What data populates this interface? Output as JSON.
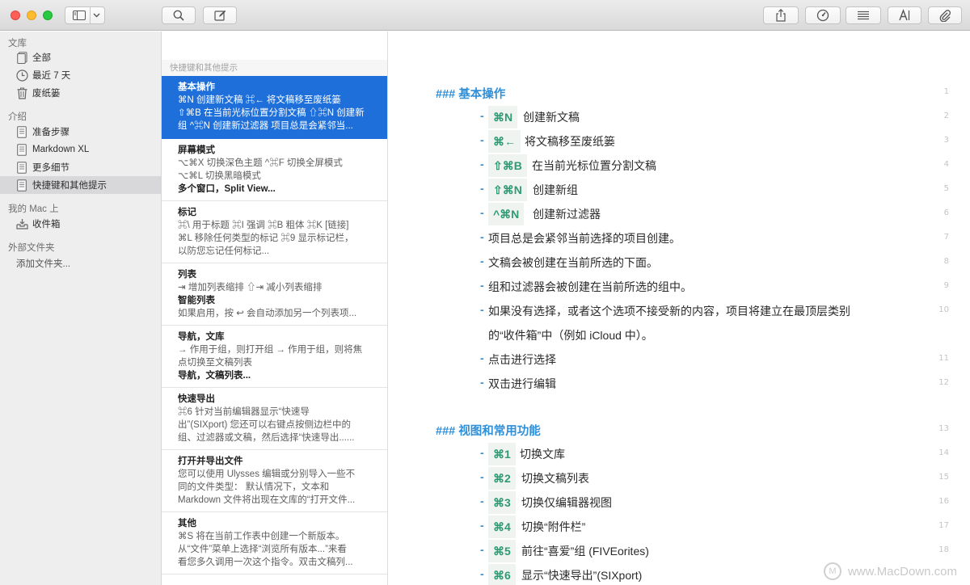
{
  "toolbar": {
    "icons": [
      "sidebar-toggle-icon",
      "chevron-down-icon",
      "search-icon",
      "compose-icon",
      "share-icon",
      "dashboard-icon",
      "list-icon",
      "typography-icon",
      "attachment-icon"
    ]
  },
  "sidebar": {
    "library_header": "文库",
    "library_items": [
      {
        "label": "全部",
        "icon": "sheets-stack-icon"
      },
      {
        "label": "最近 7 天",
        "icon": "clock-icon"
      },
      {
        "label": "废纸篓",
        "icon": "trash-icon"
      }
    ],
    "intro_header": "介绍",
    "intro_items": [
      {
        "label": "准备步骤",
        "icon": "document-icon"
      },
      {
        "label": "Markdown XL",
        "icon": "document-icon"
      },
      {
        "label": "更多细节",
        "icon": "document-icon"
      },
      {
        "label": "快捷键和其他提示",
        "icon": "document-icon"
      }
    ],
    "mac_header": "我的 Mac 上",
    "mac_items": [
      {
        "label": "收件箱",
        "icon": "inbox-icon"
      }
    ],
    "external_header": "外部文件夹",
    "add_folder": "添加文件夹..."
  },
  "list": {
    "header": "快捷键和其他提示",
    "sheets": [
      {
        "title": "基本操作",
        "lines": [
          "⌘N 创建新文稿 ⌘← 将文稿移至废纸篓",
          "⇧⌘B 在当前光标位置分割文稿 ⇧⌘N 创建新",
          "组 ^⌘N 创建新过滤器 项目总是会紧邻当..."
        ]
      },
      {
        "title": "屏幕模式",
        "lines": [
          "⌥⌘X 切换深色主题 ^⌘F 切换全屏模式",
          "⌥⌘L 切换黑暗模式"
        ],
        "bold": "多个窗口，Split View..."
      },
      {
        "title": "标记",
        "lines": [
          "⌘\\ 用于标题 ⌘I 强调 ⌘B 粗体 ⌘K [链接]",
          "⌘L 移除任何类型的标记 ⌘9 显示标记栏，",
          "以防您忘记任何标记..."
        ]
      },
      {
        "title": "列表",
        "lines": [
          "⇥ 增加列表缩排 ⇧⇥ 减小列表缩排"
        ],
        "bold": "智能列表",
        "lines2": [
          "如果启用，按 ↩ 会自动添加另一个列表项..."
        ]
      },
      {
        "title": "导航，文库",
        "lines": [
          "→ 作用于组，则打开组 → 作用于组，则将焦",
          "点切换至文稿列表"
        ],
        "bold": "导航，文稿列表..."
      },
      {
        "title": "快速导出",
        "lines": [
          "⌘6 针对当前编辑器显示“快速导",
          "出”(SIXport) 您还可以右键点按侧边栏中的",
          "组、过滤器或文稿，然后选择“快速导出......"
        ]
      },
      {
        "title": "打开并导出文件",
        "lines": [
          "您可以使用 Ulysses 编辑或分别导入一些不",
          "同的文件类型： 默认情况下，文本和",
          "Markdown 文件将出现在文库的“打开文件..."
        ]
      },
      {
        "title": "其他",
        "lines": [
          "⌘S 将在当前工作表中创建一个新版本。",
          "从“文件”菜单上选择“浏览所有版本...”来看",
          "看您多久调用一次这个指令。双击文稿列..."
        ]
      }
    ]
  },
  "editor": {
    "heading1": "### 基本操作",
    "heading2": "### 视图和常用功能",
    "dash": "-",
    "basic_items": [
      {
        "key": "⌘N",
        "text": "创建新文稿",
        "num": "2"
      },
      {
        "key": "⌘←",
        "text": "将文稿移至废纸篓",
        "num": "3"
      },
      {
        "key": "⇧⌘B",
        "text": "在当前光标位置分割文稿",
        "num": "4"
      },
      {
        "key": "⇧⌘N",
        "text": "创建新组",
        "num": "5"
      },
      {
        "key": "^⌘N",
        "text": "创建新过滤器",
        "num": "6"
      }
    ],
    "plain_items": [
      {
        "text": "项目总是会紧邻当前选择的项目创建。",
        "num": "7"
      },
      {
        "text": "文稿会被创建在当前所选的下面。",
        "num": "8"
      },
      {
        "text": "组和过滤器会被创建在当前所选的组中。",
        "num": "9"
      },
      {
        "text": "如果没有选择，或者这个选项不接受新的内容，项目将建立在最顶层类别",
        "num": "10"
      },
      {
        "text": "的“收件箱”中（例如 iCloud 中）。",
        "num": ""
      },
      {
        "text": "点击进行选择",
        "num": "11"
      },
      {
        "text": "双击进行编辑",
        "num": "12"
      }
    ],
    "heading1_num": "1",
    "heading2_num": "13",
    "view_items": [
      {
        "key": "⌘1",
        "text": "切换文库",
        "num": "14"
      },
      {
        "key": "⌘2",
        "text": "切换文稿列表",
        "num": "15"
      },
      {
        "key": "⌘3",
        "text": "切换仅编辑器视图",
        "num": "16"
      },
      {
        "key": "⌘4",
        "text": "切换“附件栏”",
        "num": "17"
      },
      {
        "key": "⌘5",
        "text": "前往“喜爱”组 (FIVEorites)",
        "num": "18"
      },
      {
        "key": "⌘6",
        "text": "显示“快速导出”(SIXport)",
        "num": ""
      }
    ]
  },
  "watermark": "www.MacDown.com"
}
